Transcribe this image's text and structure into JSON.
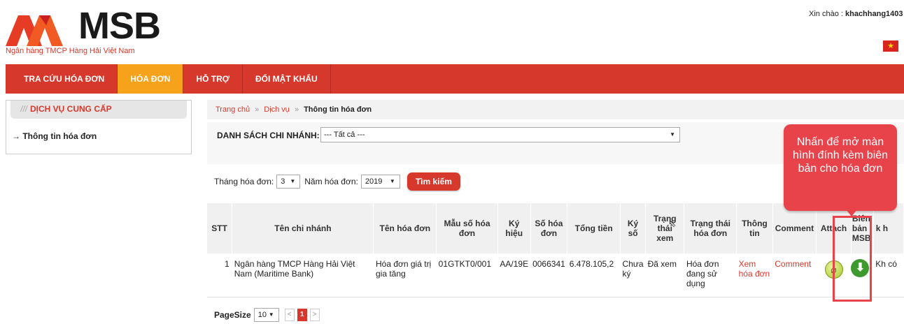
{
  "header": {
    "logo_text": "MSB",
    "logo_subtitle": "Ngân hàng TMCP Hàng Hải Việt Nam",
    "greeting_prefix": "Xin chào :",
    "username": "khachhang1403"
  },
  "nav": {
    "items": [
      {
        "label": "TRA CỨU HÓA ĐƠN"
      },
      {
        "label": "HÓA ĐƠN"
      },
      {
        "label": "HỖ TRỢ"
      },
      {
        "label": "ĐỔI MẬT KHẨU"
      }
    ],
    "active_index": 1
  },
  "sidebar": {
    "title": "DỊCH VỤ CUNG CẤP",
    "items": [
      {
        "label": "→ Thông tin hóa đơn"
      }
    ]
  },
  "breadcrumb": {
    "home": "Trang chủ",
    "sep": "»",
    "service": "Dịch vụ",
    "current": "Thông tin hóa đơn"
  },
  "branch_filter": {
    "label": "DANH SÁCH CHI NHÁNH:",
    "value": "--- Tất cả ---"
  },
  "filters": {
    "month_label": "Tháng hóa đơn:",
    "month_value": "3",
    "year_label": "Năm hóa đơn:",
    "year_value": "2019",
    "search_label": "Tìm kiếm"
  },
  "table": {
    "headers": {
      "stt": "STT",
      "branch": "Tên chi nhánh",
      "invoice_name": "Tên hóa đơn",
      "template": "Mẫu số hóa đơn",
      "symbol": "Ký hiệu",
      "number": "Số hóa đơn",
      "total": "Tổng tiền",
      "signed": "Ký số",
      "view_status": "Trạng thái xem",
      "invoice_status": "Trạng thái hóa đơn",
      "info": "Thông tin",
      "comment": "Comment",
      "attach": "Attach",
      "msb_record": "Biên bản MSB",
      "extra": "k h"
    },
    "rows": [
      {
        "stt": "1",
        "branch": "Ngân hàng TMCP Hàng Hải Việt Nam (Maritime Bank)",
        "invoice_name": "Hóa đơn giá trị gia tăng",
        "template": "01GTKT0/001",
        "symbol": "AA/19E",
        "number": "0066341",
        "total": "6.478.105,2",
        "signed": "Chưa ký",
        "view_status": "Đã xem",
        "invoice_status": "Hóa đơn đang sử dụng",
        "info": "Xem hóa đơn",
        "comment": "Comment",
        "attach_icon": "paperclip-icon",
        "msb_icon": "download-arrow-icon",
        "extra": "Kh có"
      }
    ]
  },
  "pager": {
    "label": "PageSize",
    "size": "10",
    "prev": "<",
    "page": "1",
    "next": ">"
  },
  "callout": {
    "text": "Nhấn để mở màn hình đính kèm biên bản cho hóa đơn"
  },
  "colors": {
    "brand_red": "#d7382c",
    "active_orange": "#f7a21b",
    "callout_red": "#e8424a"
  }
}
